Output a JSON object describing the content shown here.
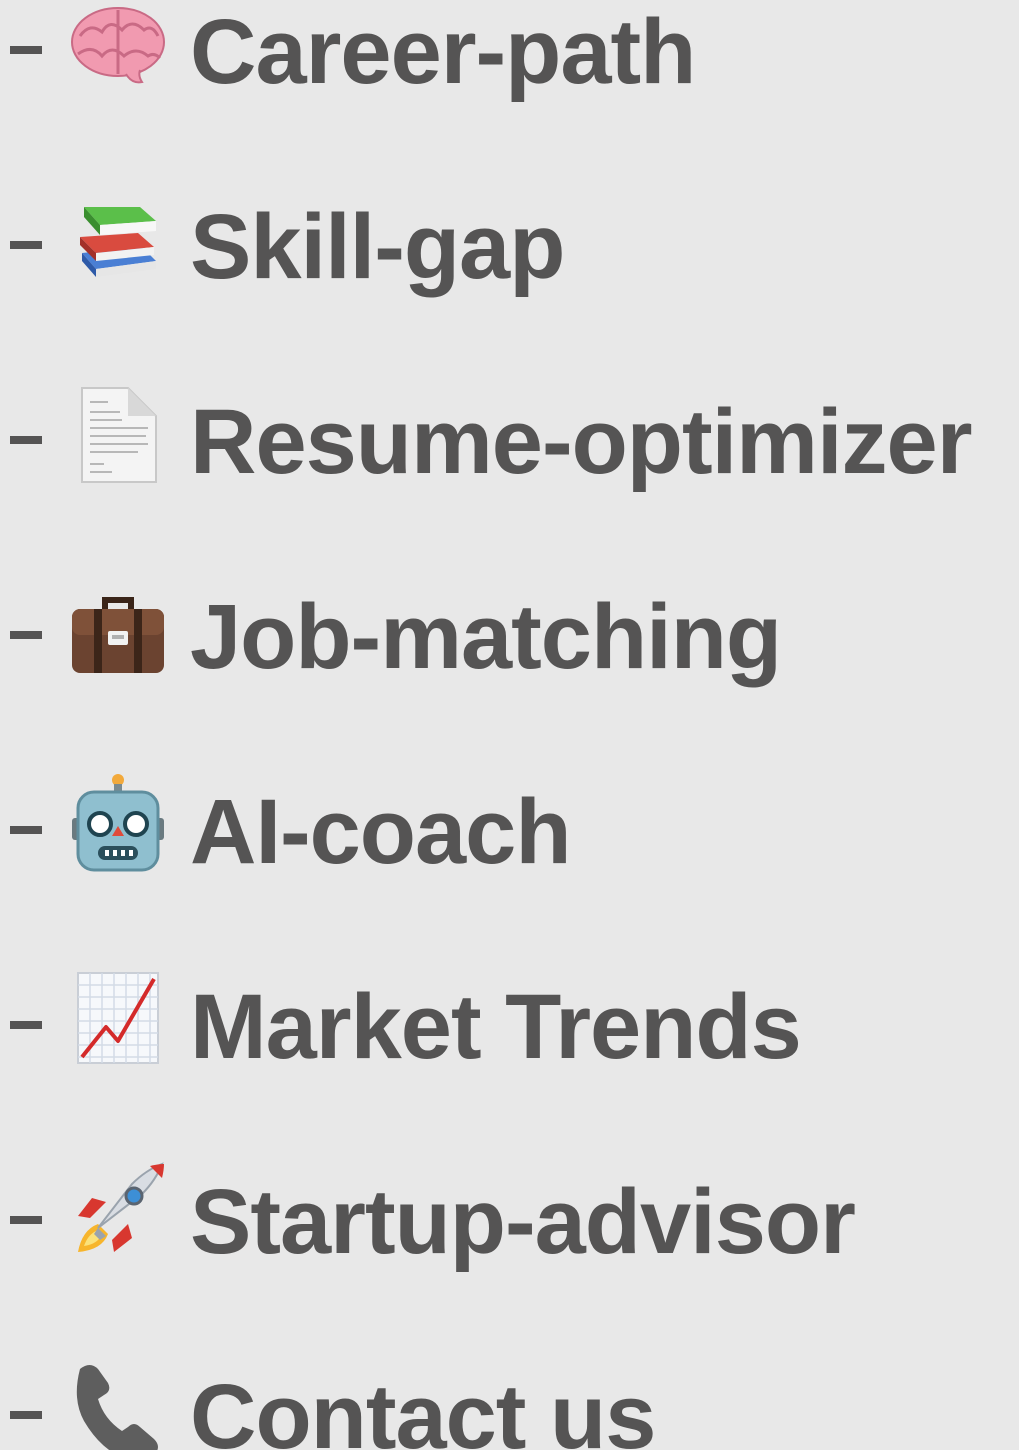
{
  "menu": {
    "items": [
      {
        "bullet": "-",
        "icon": "brain-icon",
        "label": "Career-path"
      },
      {
        "bullet": "-",
        "icon": "books-icon",
        "label": "Skill-gap"
      },
      {
        "bullet": "-",
        "icon": "document-icon",
        "label": "Resume-optimizer"
      },
      {
        "bullet": "-",
        "icon": "briefcase-icon",
        "label": "Job-matching"
      },
      {
        "bullet": "-",
        "icon": "robot-icon",
        "label": "AI-coach"
      },
      {
        "bullet": "-",
        "icon": "chart-increasing-icon",
        "label": "Market Trends"
      },
      {
        "bullet": "-",
        "icon": "rocket-icon",
        "label": "Startup-advisor"
      },
      {
        "bullet": "-",
        "icon": "telephone-icon",
        "label": "Contact us"
      }
    ]
  },
  "colors": {
    "background": "#e8e8e8",
    "text": "#555454"
  }
}
